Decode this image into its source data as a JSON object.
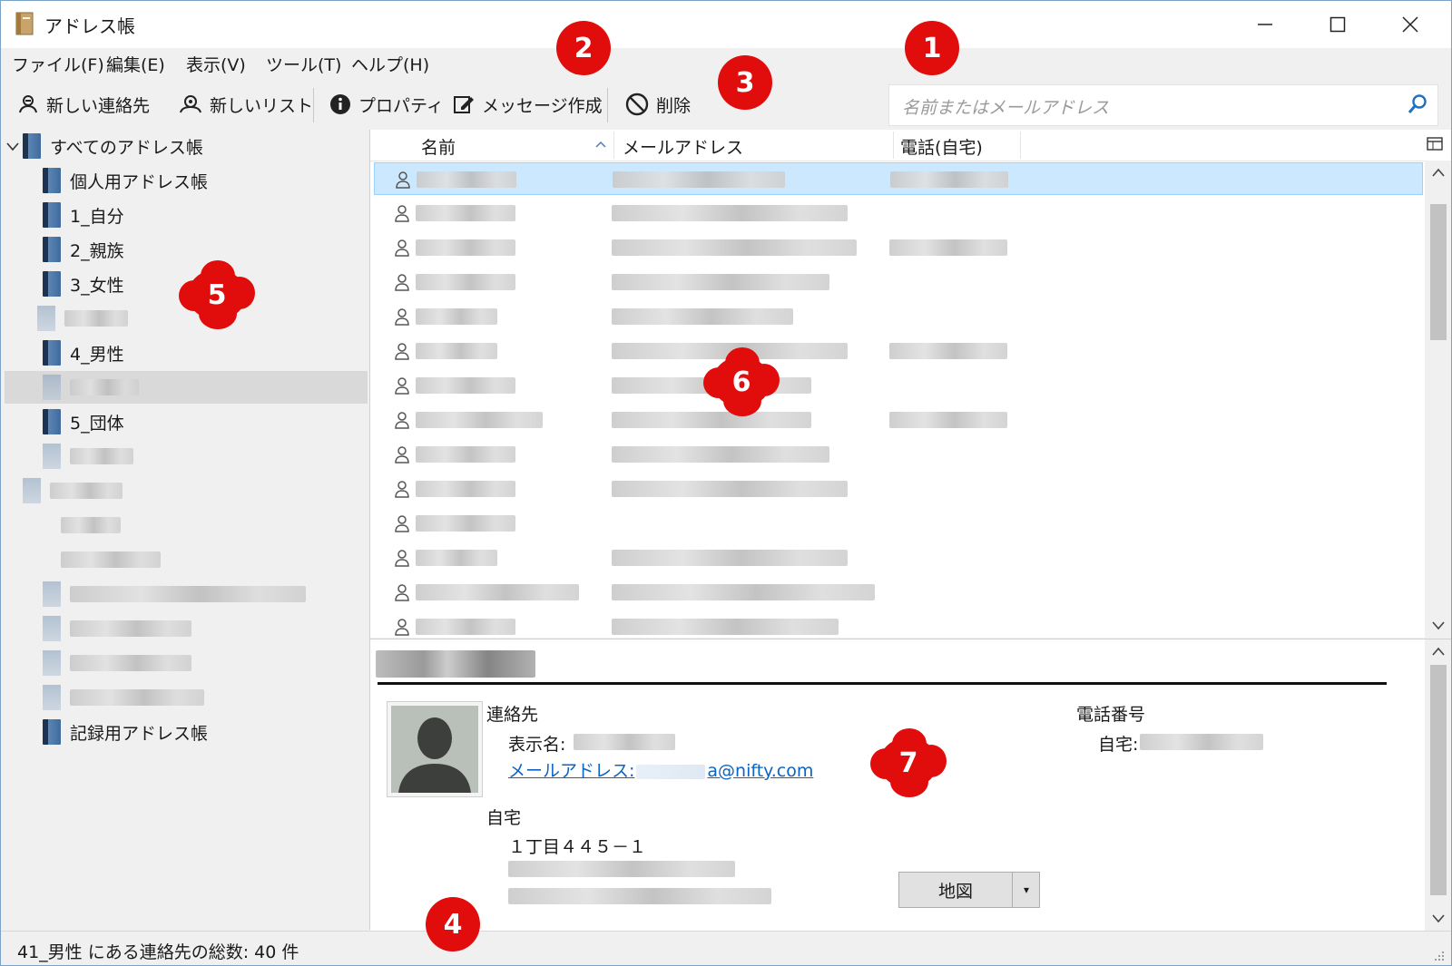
{
  "window": {
    "title": "アドレス帳"
  },
  "menu": [
    {
      "label": "ファイル(F)"
    },
    {
      "label": "編集(E)"
    },
    {
      "label": "表示(V)"
    },
    {
      "label": "ツール(T)"
    },
    {
      "label": "ヘルプ(H)"
    }
  ],
  "toolbar": {
    "new_contact": "新しい連絡先",
    "new_list": "新しいリスト",
    "properties": "プロパティ",
    "compose": "メッセージ作成",
    "delete": "削除"
  },
  "search": {
    "placeholder": "名前またはメールアドレス"
  },
  "tree": {
    "root": "すべてのアドレス帳",
    "items": [
      "個人用アドレス帳",
      "1_自分",
      "2_親族",
      "3_女性",
      "4_男性",
      "5_団体",
      "記録用アドレス帳"
    ]
  },
  "list": {
    "columns": {
      "name": "名前",
      "email": "メールアドレス",
      "phone": "電話(自宅)"
    }
  },
  "details": {
    "contact_heading": "連絡先",
    "display_name_label": "表示名:",
    "email_label": "メールアドレス:",
    "email_visible": "a@nifty.com",
    "phone_heading": "電話番号",
    "home_phone_label": "自宅:",
    "home_heading": "自宅",
    "address_line1": "１丁目４４５－１",
    "map_button": "地図"
  },
  "status": {
    "text": "41_男性 にある連絡先の総数: 40 件"
  },
  "callouts": [
    "1",
    "2",
    "3",
    "4",
    "5",
    "6",
    "7"
  ],
  "colors": {
    "selection": "#cce8ff",
    "callout": "#e10c0c",
    "link": "#0b63c4"
  }
}
